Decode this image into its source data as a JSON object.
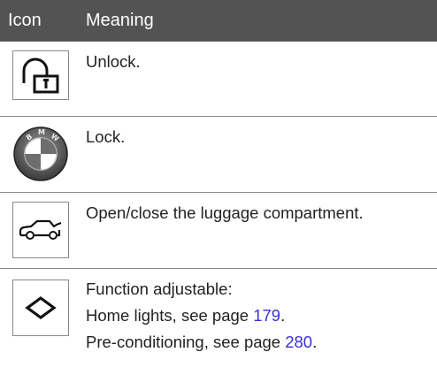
{
  "header": {
    "icon_col": "Icon",
    "meaning_col": "Meaning"
  },
  "rows": [
    {
      "icon": "unlock-padlock-icon",
      "lines": [
        {
          "text": "Unlock."
        }
      ]
    },
    {
      "icon": "bmw-roundel-icon",
      "lines": [
        {
          "text": "Lock."
        }
      ]
    },
    {
      "icon": "car-trunk-open-icon",
      "lines": [
        {
          "text": "Open/close the luggage compartment."
        }
      ]
    },
    {
      "icon": "diamond-icon",
      "lines": [
        {
          "text": "Function adjustable:"
        },
        {
          "prefix": "Home lights, see page ",
          "page": "179",
          "suffix": "."
        },
        {
          "prefix": "Pre-conditioning, see page ",
          "page": "280",
          "suffix": "."
        }
      ]
    }
  ],
  "colors": {
    "header_bg": "#535353",
    "link": "#3b2fd6",
    "divider": "#8a8a8a"
  }
}
